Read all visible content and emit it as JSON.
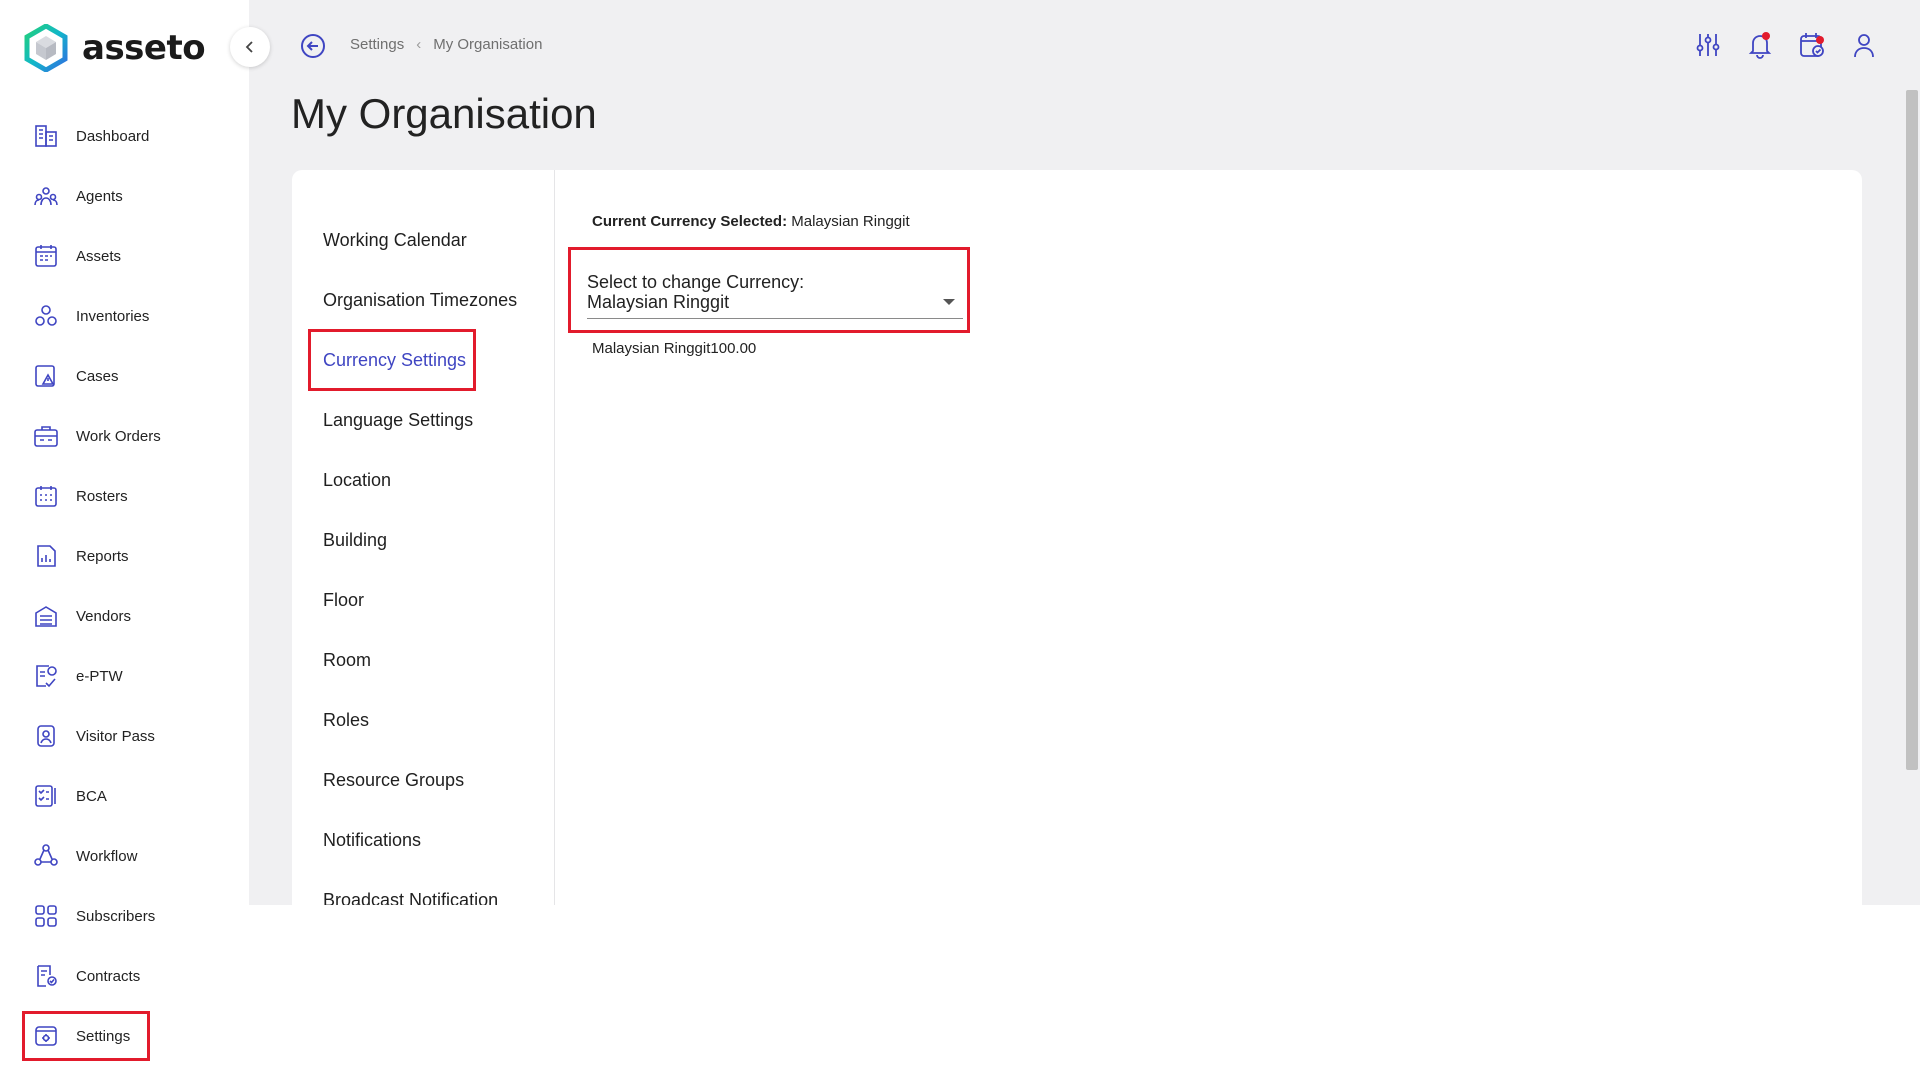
{
  "brand": {
    "name": "asseto"
  },
  "sidebar": {
    "items": [
      {
        "label": "Dashboard",
        "icon": "dashboard-icon"
      },
      {
        "label": "Agents",
        "icon": "agents-icon"
      },
      {
        "label": "Assets",
        "icon": "assets-icon"
      },
      {
        "label": "Inventories",
        "icon": "inventories-icon"
      },
      {
        "label": "Cases",
        "icon": "cases-icon"
      },
      {
        "label": "Work Orders",
        "icon": "work-orders-icon"
      },
      {
        "label": "Rosters",
        "icon": "rosters-icon"
      },
      {
        "label": "Reports",
        "icon": "reports-icon"
      },
      {
        "label": "Vendors",
        "icon": "vendors-icon"
      },
      {
        "label": "e-PTW",
        "icon": "eptw-icon"
      },
      {
        "label": "Visitor Pass",
        "icon": "visitor-pass-icon"
      },
      {
        "label": "BCA",
        "icon": "bca-icon"
      },
      {
        "label": "Workflow",
        "icon": "workflow-icon"
      },
      {
        "label": "Subscribers",
        "icon": "subscribers-icon"
      },
      {
        "label": "Contracts",
        "icon": "contracts-icon"
      },
      {
        "label": "Settings",
        "icon": "settings-icon",
        "active": true
      }
    ]
  },
  "breadcrumb": {
    "parent": "Settings",
    "current": "My Organisation"
  },
  "page": {
    "title": "My Organisation"
  },
  "subnav": {
    "items": [
      "Working Calendar",
      "Organisation Timezones",
      "Currency Settings",
      "Language Settings",
      "Location",
      "Building",
      "Floor",
      "Room",
      "Roles",
      "Resource Groups",
      "Notifications",
      "Broadcast Notification"
    ],
    "active_index": 2
  },
  "currency": {
    "current_label": "Current Currency Selected:",
    "current_value": "Malaysian Ringgit",
    "select_label": "Select to change Currency:",
    "select_value": "Malaysian Ringgit",
    "amount_preview": "Malaysian Ringgit100.00"
  },
  "toolbar": {
    "icons": [
      "filter-sliders-icon",
      "notification-bell-icon",
      "task-calendar-icon",
      "user-profile-icon"
    ]
  },
  "colors": {
    "accent": "#3f45c2",
    "highlight": "#e21b2c",
    "background": "#f0f0f2"
  }
}
